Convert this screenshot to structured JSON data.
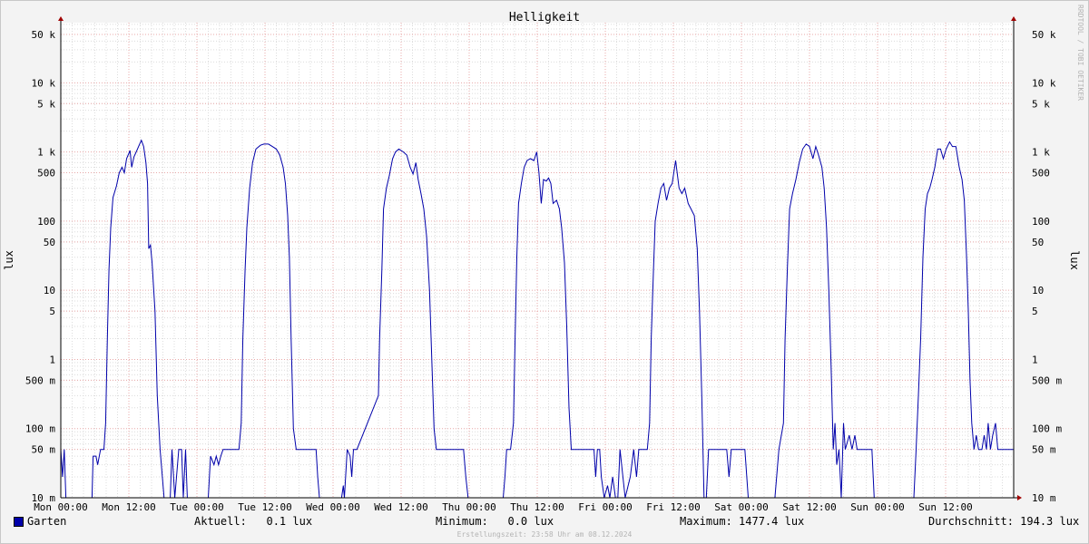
{
  "chart_data": {
    "type": "line",
    "title": "Helligkeit",
    "ylabel": "lux",
    "yscale": "log",
    "ylim": [
      10,
      80000
    ],
    "grid": true,
    "y_ticks": [
      {
        "v": 50000,
        "label": "50 k"
      },
      {
        "v": 10000,
        "label": "10 k"
      },
      {
        "v": 5000,
        "label": "5 k"
      },
      {
        "v": 1000,
        "label": "1 k"
      },
      {
        "v": 500,
        "label": "500"
      },
      {
        "v": 100,
        "label": "100"
      },
      {
        "v": 50,
        "label": "50"
      },
      {
        "v": 10,
        "label": "10"
      },
      {
        "v": 5,
        "label": "5"
      },
      {
        "v": 1,
        "label": "1"
      },
      {
        "v": 0.5,
        "label": "500 m"
      },
      {
        "v": 0.1,
        "label": "100 m"
      },
      {
        "v": 0.05,
        "label": "50 m"
      },
      {
        "v": 0.01,
        "label": "10 m"
      }
    ],
    "x_ticks": [
      "Mon 00:00",
      "Mon 12:00",
      "Tue 00:00",
      "Tue 12:00",
      "Wed 00:00",
      "Wed 12:00",
      "Thu 00:00",
      "Thu 12:00",
      "Fri 00:00",
      "Fri 12:00",
      "Sat 00:00",
      "Sat 12:00",
      "Sun 00:00",
      "Sun 12:00"
    ],
    "x_unit": "hours since Mon 00:00",
    "xlim": [
      0,
      168
    ],
    "series": [
      {
        "name": "Garten",
        "color": "#0000aa",
        "points": [
          [
            0,
            0.05
          ],
          [
            0.3,
            0.02
          ],
          [
            0.6,
            0.05
          ],
          [
            0.9,
            0.01
          ],
          [
            4,
            0.01
          ],
          [
            5.5,
            0.01
          ],
          [
            5.7,
            0.04
          ],
          [
            6.2,
            0.04
          ],
          [
            6.5,
            0.03
          ],
          [
            7,
            0.05
          ],
          [
            7.6,
            0.05
          ],
          [
            7.9,
            0.12
          ],
          [
            8.2,
            2
          ],
          [
            8.5,
            20
          ],
          [
            8.8,
            80
          ],
          [
            9.2,
            220
          ],
          [
            9.8,
            320
          ],
          [
            10.3,
            500
          ],
          [
            10.8,
            600
          ],
          [
            11.2,
            500
          ],
          [
            11.6,
            800
          ],
          [
            12.2,
            1050
          ],
          [
            12.5,
            600
          ],
          [
            12.9,
            850
          ],
          [
            13.4,
            1050
          ],
          [
            13.8,
            1250
          ],
          [
            14.2,
            1477
          ],
          [
            14.6,
            1200
          ],
          [
            15,
            700
          ],
          [
            15.3,
            350
          ],
          [
            15.5,
            40
          ],
          [
            15.8,
            45
          ],
          [
            16.1,
            25
          ],
          [
            16.6,
            5
          ],
          [
            17,
            0.3
          ],
          [
            17.5,
            0.05
          ],
          [
            17.9,
            0.02
          ],
          [
            18.2,
            0.01
          ],
          [
            19.3,
            0.01
          ],
          [
            19.6,
            0.05
          ],
          [
            20.1,
            0.01
          ],
          [
            20.8,
            0.05
          ],
          [
            21.3,
            0.05
          ],
          [
            21.6,
            0.01
          ],
          [
            22,
            0.05
          ],
          [
            22.3,
            0.01
          ],
          [
            26,
            0.01
          ],
          [
            26.4,
            0.04
          ],
          [
            27,
            0.03
          ],
          [
            27.4,
            0.04
          ],
          [
            27.8,
            0.03
          ],
          [
            28.2,
            0.04
          ],
          [
            28.6,
            0.05
          ],
          [
            31.4,
            0.05
          ],
          [
            31.8,
            0.12
          ],
          [
            32.1,
            2
          ],
          [
            32.5,
            20
          ],
          [
            32.8,
            80
          ],
          [
            33.3,
            300
          ],
          [
            33.8,
            700
          ],
          [
            34.4,
            1100
          ],
          [
            35.2,
            1250
          ],
          [
            35.8,
            1300
          ],
          [
            36.6,
            1300
          ],
          [
            37.3,
            1200
          ],
          [
            38,
            1100
          ],
          [
            38.6,
            900
          ],
          [
            39.2,
            600
          ],
          [
            39.6,
            350
          ],
          [
            40,
            120
          ],
          [
            40.3,
            30
          ],
          [
            40.6,
            2
          ],
          [
            41,
            0.1
          ],
          [
            41.5,
            0.05
          ],
          [
            45,
            0.05
          ],
          [
            45.3,
            0.02
          ],
          [
            45.6,
            0.01
          ],
          [
            49.5,
            0.01
          ],
          [
            49.8,
            0.015
          ],
          [
            50,
            0.01
          ],
          [
            50.5,
            0.05
          ],
          [
            51,
            0.04
          ],
          [
            51.3,
            0.02
          ],
          [
            51.6,
            0.05
          ],
          [
            52.2,
            0.05
          ],
          [
            56,
            0.3
          ],
          [
            56.2,
            2
          ],
          [
            56.6,
            20
          ],
          [
            56.9,
            150
          ],
          [
            57.4,
            300
          ],
          [
            57.9,
            450
          ],
          [
            58.5,
            800
          ],
          [
            59,
            1000
          ],
          [
            59.6,
            1100
          ],
          [
            60.4,
            1000
          ],
          [
            61,
            900
          ],
          [
            61.6,
            600
          ],
          [
            62.1,
            480
          ],
          [
            62.6,
            700
          ],
          [
            63,
            400
          ],
          [
            63.5,
            250
          ],
          [
            64,
            150
          ],
          [
            64.5,
            60
          ],
          [
            65,
            10
          ],
          [
            65.4,
            1
          ],
          [
            65.8,
            0.1
          ],
          [
            66.2,
            0.05
          ],
          [
            70,
            0.05
          ],
          [
            71,
            0.05
          ],
          [
            71.4,
            0.02
          ],
          [
            71.8,
            0.01
          ],
          [
            78,
            0.01
          ],
          [
            78.3,
            0.02
          ],
          [
            78.6,
            0.05
          ],
          [
            79.3,
            0.05
          ],
          [
            79.8,
            0.12
          ],
          [
            80.1,
            2
          ],
          [
            80.4,
            30
          ],
          [
            80.7,
            180
          ],
          [
            81.2,
            350
          ],
          [
            81.7,
            600
          ],
          [
            82.2,
            750
          ],
          [
            82.8,
            800
          ],
          [
            83.4,
            750
          ],
          [
            83.9,
            1000
          ],
          [
            84.3,
            500
          ],
          [
            84.7,
            180
          ],
          [
            85.1,
            400
          ],
          [
            85.6,
            380
          ],
          [
            86,
            420
          ],
          [
            86.4,
            350
          ],
          [
            86.8,
            180
          ],
          [
            87.4,
            200
          ],
          [
            87.9,
            150
          ],
          [
            88.3,
            80
          ],
          [
            88.8,
            25
          ],
          [
            89.2,
            3
          ],
          [
            89.6,
            0.2
          ],
          [
            90,
            0.05
          ],
          [
            94,
            0.05
          ],
          [
            94.3,
            0.02
          ],
          [
            94.6,
            0.05
          ],
          [
            95,
            0.05
          ],
          [
            95.3,
            0.02
          ],
          [
            95.8,
            0.01
          ],
          [
            96.4,
            0.015
          ],
          [
            96.8,
            0.01
          ],
          [
            97.3,
            0.02
          ],
          [
            97.8,
            0.01
          ],
          [
            98.2,
            0.01
          ],
          [
            98.6,
            0.05
          ],
          [
            99.1,
            0.02
          ],
          [
            99.5,
            0.01
          ],
          [
            100.4,
            0.02
          ],
          [
            101,
            0.05
          ],
          [
            101.5,
            0.02
          ],
          [
            101.9,
            0.05
          ],
          [
            103.4,
            0.05
          ],
          [
            103.8,
            0.12
          ],
          [
            104.1,
            2
          ],
          [
            104.5,
            20
          ],
          [
            104.8,
            100
          ],
          [
            105.3,
            180
          ],
          [
            105.8,
            300
          ],
          [
            106.3,
            350
          ],
          [
            106.8,
            200
          ],
          [
            107.3,
            300
          ],
          [
            107.8,
            350
          ],
          [
            108.4,
            750
          ],
          [
            109,
            300
          ],
          [
            109.5,
            250
          ],
          [
            110,
            300
          ],
          [
            110.6,
            180
          ],
          [
            111.1,
            150
          ],
          [
            111.7,
            120
          ],
          [
            112.2,
            40
          ],
          [
            112.6,
            5
          ],
          [
            113,
            0.3
          ],
          [
            113.4,
            0.01
          ],
          [
            113.8,
            0.01
          ],
          [
            114.2,
            0.05
          ],
          [
            117.4,
            0.05
          ],
          [
            117.8,
            0.02
          ],
          [
            118.2,
            0.05
          ],
          [
            119.4,
            0.05
          ],
          [
            120.6,
            0.05
          ],
          [
            121.2,
            0.01
          ],
          [
            125.9,
            0.01
          ],
          [
            126.6,
            0.05
          ],
          [
            127.4,
            0.12
          ],
          [
            127.7,
            2
          ],
          [
            128.1,
            20
          ],
          [
            128.5,
            150
          ],
          [
            129,
            250
          ],
          [
            129.6,
            400
          ],
          [
            130.2,
            700
          ],
          [
            130.8,
            1100
          ],
          [
            131.4,
            1300
          ],
          [
            132,
            1200
          ],
          [
            132.6,
            800
          ],
          [
            133.1,
            1200
          ],
          [
            133.6,
            900
          ],
          [
            134.2,
            600
          ],
          [
            134.6,
            300
          ],
          [
            135,
            80
          ],
          [
            135.4,
            10
          ],
          [
            135.8,
            0.8
          ],
          [
            136.2,
            0.05
          ],
          [
            136.5,
            0.12
          ],
          [
            136.8,
            0.03
          ],
          [
            137.2,
            0.05
          ],
          [
            137.6,
            0.01
          ],
          [
            138,
            0.12
          ],
          [
            138.3,
            0.05
          ],
          [
            139,
            0.08
          ],
          [
            139.5,
            0.05
          ],
          [
            140,
            0.08
          ],
          [
            140.4,
            0.05
          ],
          [
            143,
            0.05
          ],
          [
            143.4,
            0.01
          ],
          [
            150.4,
            0.01
          ],
          [
            150.8,
            0.05
          ],
          [
            151.2,
            0.3
          ],
          [
            151.6,
            2
          ],
          [
            152,
            30
          ],
          [
            152.4,
            150
          ],
          [
            152.8,
            250
          ],
          [
            153.2,
            300
          ],
          [
            153.6,
            400
          ],
          [
            154.1,
            600
          ],
          [
            154.6,
            1100
          ],
          [
            155.1,
            1100
          ],
          [
            155.6,
            800
          ],
          [
            156.1,
            1100
          ],
          [
            156.7,
            1400
          ],
          [
            157.2,
            1200
          ],
          [
            157.8,
            1200
          ],
          [
            158.4,
            600
          ],
          [
            158.9,
            400
          ],
          [
            159.3,
            200
          ],
          [
            159.7,
            30
          ],
          [
            160,
            5
          ],
          [
            160.3,
            0.5
          ],
          [
            160.6,
            0.12
          ],
          [
            161,
            0.05
          ],
          [
            161.4,
            0.08
          ],
          [
            161.8,
            0.05
          ],
          [
            162.4,
            0.05
          ],
          [
            162.8,
            0.08
          ],
          [
            163.2,
            0.05
          ],
          [
            163.5,
            0.12
          ],
          [
            163.9,
            0.05
          ],
          [
            164.3,
            0.08
          ],
          [
            164.8,
            0.12
          ],
          [
            165.2,
            0.05
          ],
          [
            168,
            0.05
          ]
        ]
      }
    ]
  },
  "legend": {
    "series_name": "Garten",
    "current_label": "Aktuell:",
    "current_value": "0.1 lux",
    "min_label": "Minimum:",
    "min_value": "0.0 lux",
    "max_label": "Maximum:",
    "max_value": "1477.4 lux",
    "avg_label": "Durchschnitt:",
    "avg_value": "194.3 lux"
  },
  "watermark": "RRDTOOL / TOBI OETIKER",
  "footer": "Erstellungszeit: 23:58 Uhr am 08.12.2024"
}
